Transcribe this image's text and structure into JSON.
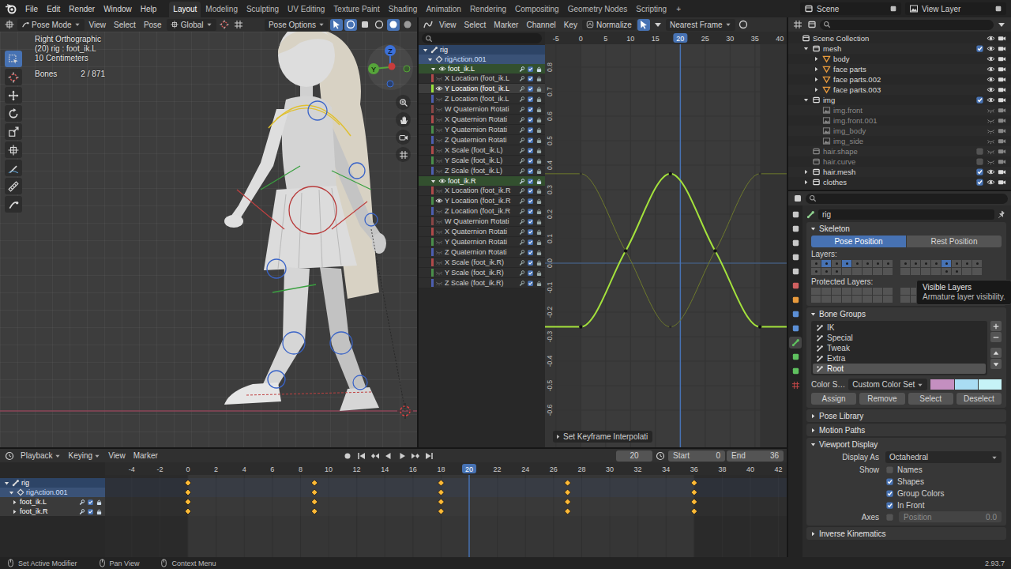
{
  "topbar": {
    "menus": [
      "File",
      "Edit",
      "Render",
      "Window",
      "Help"
    ],
    "workspaces": [
      {
        "label": "Layout",
        "selected": true
      },
      {
        "label": "Modeling",
        "selected": false
      },
      {
        "label": "Sculpting",
        "selected": false
      },
      {
        "label": "UV Editing",
        "selected": false
      },
      {
        "label": "Texture Paint",
        "selected": false
      },
      {
        "label": "Shading",
        "selected": false
      },
      {
        "label": "Animation",
        "selected": false
      },
      {
        "label": "Rendering",
        "selected": false
      },
      {
        "label": "Compositing",
        "selected": false
      },
      {
        "label": "Geometry Nodes",
        "selected": false
      },
      {
        "label": "Scripting",
        "selected": false
      }
    ],
    "add_tab": "+",
    "scene": "Scene",
    "view_layer": "View Layer"
  },
  "viewport": {
    "mode": "Pose Mode",
    "menus": [
      "View",
      "Select",
      "Pose"
    ],
    "orientation": "Global",
    "pose_options": "Pose Options",
    "info": [
      "Right Orthographic",
      "(20) rig : foot_ik.L",
      "10 Centimeters"
    ],
    "stats": {
      "label": "Bones",
      "value": "2 / 871"
    },
    "gizmo": {
      "up": "Z",
      "side": "Y"
    },
    "tools": [
      {
        "selected": true
      },
      {
        "selected": false
      },
      {
        "selected": false
      },
      {
        "selected": false
      },
      {
        "selected": false
      },
      {
        "selected": false
      },
      {
        "selected": false
      },
      {
        "selected": false
      },
      {
        "selected": false
      }
    ]
  },
  "graph": {
    "menus": [
      "View",
      "Select",
      "Marker",
      "Channel",
      "Key"
    ],
    "normalize": {
      "label": "Normalize",
      "on": false
    },
    "snap": "Nearest Frame",
    "channels": [
      {
        "label": "rig",
        "kind": "object",
        "expanded": true
      },
      {
        "label": "rigAction.001",
        "kind": "action",
        "expanded": true
      },
      {
        "label": "foot_ik.L",
        "kind": "group",
        "expanded": true
      },
      {
        "label": "X Location (foot_ik.L",
        "kind": "fcurve",
        "color": "#b04a4a",
        "visible": false,
        "selected": false
      },
      {
        "label": "Y Location (foot_ik.L",
        "kind": "fcurve",
        "color": "#9be03a",
        "visible": true,
        "selected": true
      },
      {
        "label": "Z Location (foot_ik.L",
        "kind": "fcurve",
        "color": "#4d5fb0",
        "visible": false,
        "selected": false
      },
      {
        "label": "W Quaternion Rotati",
        "kind": "fcurve",
        "color": "#8a4646",
        "visible": false,
        "selected": false
      },
      {
        "label": "X Quaternion Rotati",
        "kind": "fcurve",
        "color": "#b04a4a",
        "visible": false,
        "selected": false
      },
      {
        "label": "Y Quaternion Rotati",
        "kind": "fcurve",
        "color": "#4a8f4a",
        "visible": false,
        "selected": false
      },
      {
        "label": "Z Quaternion Rotati",
        "kind": "fcurve",
        "color": "#4d5fb0",
        "visible": false,
        "selected": false
      },
      {
        "label": "X Scale (foot_ik.L)",
        "kind": "fcurve",
        "color": "#b04a4a",
        "visible": false,
        "selected": false
      },
      {
        "label": "Y Scale (foot_ik.L)",
        "kind": "fcurve",
        "color": "#4a8f4a",
        "visible": false,
        "selected": false
      },
      {
        "label": "Z Scale (foot_ik.L)",
        "kind": "fcurve",
        "color": "#4d5fb0",
        "visible": false,
        "selected": false
      },
      {
        "label": "foot_ik.R",
        "kind": "group",
        "expanded": true
      },
      {
        "label": "X Location (foot_ik.R",
        "kind": "fcurve",
        "color": "#b04a4a",
        "visible": false,
        "selected": false
      },
      {
        "label": "Y Location (foot_ik.R",
        "kind": "fcurve",
        "color": "#4a8f4a",
        "visible": true,
        "selected": false
      },
      {
        "label": "Z Location (foot_ik.R",
        "kind": "fcurve",
        "color": "#4d5fb0",
        "visible": false,
        "selected": false
      },
      {
        "label": "W Quaternion Rotati",
        "kind": "fcurve",
        "color": "#8a4646",
        "visible": false,
        "selected": false
      },
      {
        "label": "X Quaternion Rotati",
        "kind": "fcurve",
        "color": "#b04a4a",
        "visible": false,
        "selected": false
      },
      {
        "label": "Y Quaternion Rotati",
        "kind": "fcurve",
        "color": "#4a8f4a",
        "visible": false,
        "selected": false
      },
      {
        "label": "Z Quaternion Rotati",
        "kind": "fcurve",
        "color": "#4d5fb0",
        "visible": false,
        "selected": false
      },
      {
        "label": "X Scale (foot_ik.R)",
        "kind": "fcurve",
        "color": "#b04a4a",
        "visible": false,
        "selected": false
      },
      {
        "label": "Y Scale (foot_ik.R)",
        "kind": "fcurve",
        "color": "#4a8f4a",
        "visible": false,
        "selected": false
      },
      {
        "label": "Z Scale (foot_ik.R)",
        "kind": "fcurve",
        "color": "#4d5fb0",
        "visible": false,
        "selected": false
      }
    ],
    "frame_ticks": [
      "-5",
      "0",
      "5",
      "10",
      "15",
      "20",
      "25",
      "30",
      "35",
      "40"
    ],
    "value_ticks": [
      "0.8",
      "0.7",
      "0.6",
      "0.5",
      "0.4",
      "0.3",
      "0.2",
      "0.1",
      "0.0",
      "-0.1",
      "-0.2",
      "-0.3",
      "-0.4",
      "-0.5",
      "-0.6"
    ],
    "current_frame": "20",
    "cursor_value": 0,
    "curves": [
      {
        "selected": false,
        "color": "#6e7a2c",
        "frames": [
          0,
          9,
          18,
          27,
          36
        ],
        "values": [
          0.365,
          0.05,
          -0.26,
          0.05,
          0.365
        ]
      },
      {
        "selected": true,
        "color": "#a4e23c",
        "frames": [
          0,
          9,
          18,
          27,
          36
        ],
        "values": [
          -0.26,
          0.05,
          0.365,
          0.05,
          -0.26
        ]
      }
    ],
    "operator_panel": "Set Keyframe Interpolati"
  },
  "outliner": {
    "rows": [
      {
        "name": "Scene Collection",
        "depth": 0,
        "kind": "scene",
        "visible": true
      },
      {
        "name": "mesh",
        "depth": 1,
        "kind": "collection",
        "expanded": true,
        "checked": true,
        "visible": true
      },
      {
        "name": "body",
        "depth": 2,
        "kind": "mesh",
        "expanded": false,
        "visible": true
      },
      {
        "name": "face parts",
        "depth": 2,
        "kind": "mesh",
        "expanded": false,
        "visible": true
      },
      {
        "name": "face parts.002",
        "depth": 2,
        "kind": "mesh",
        "expanded": false,
        "visible": true
      },
      {
        "name": "face parts.003",
        "depth": 2,
        "kind": "mesh",
        "expanded": false,
        "visible": true
      },
      {
        "name": "img",
        "depth": 1,
        "kind": "collection",
        "expanded": true,
        "checked": true,
        "visible": true
      },
      {
        "name": "img.front",
        "depth": 2,
        "kind": "image",
        "visible": false
      },
      {
        "name": "img.front.001",
        "depth": 2,
        "kind": "image",
        "visible": false
      },
      {
        "name": "img_body",
        "depth": 2,
        "kind": "image",
        "visible": false
      },
      {
        "name": "img_side",
        "depth": 2,
        "kind": "image",
        "visible": false
      },
      {
        "name": "hair.shape",
        "depth": 1,
        "kind": "collection",
        "checked": false,
        "visible": false
      },
      {
        "name": "hair.curve",
        "depth": 1,
        "kind": "collection",
        "checked": false,
        "visible": false
      },
      {
        "name": "hair.mesh",
        "depth": 1,
        "kind": "collection",
        "expanded": false,
        "checked": true,
        "visible": true
      },
      {
        "name": "clothes",
        "depth": 1,
        "kind": "collection",
        "expanded": false,
        "checked": true,
        "visible": true
      }
    ]
  },
  "properties": {
    "tabs": [
      {
        "selected": false
      },
      {
        "selected": false
      },
      {
        "selected": false
      },
      {
        "selected": false
      },
      {
        "selected": false
      },
      {
        "selected": false
      },
      {
        "selected": false
      },
      {
        "selected": false
      },
      {
        "selected": false
      },
      {
        "selected": true
      },
      {
        "selected": false
      },
      {
        "selected": false
      },
      {
        "selected": false
      }
    ],
    "object": "rig",
    "skeleton": {
      "title": "Skeleton",
      "expanded": true,
      "positions": [
        {
          "label": "Pose Position",
          "selected": true
        },
        {
          "label": "Rest Position",
          "selected": false
        }
      ],
      "layers_label": "Layers:",
      "layers": [
        {
          "on": false,
          "used": true
        },
        {
          "on": true,
          "used": true
        },
        {
          "on": false,
          "used": true
        },
        {
          "on": true,
          "used": true
        },
        {
          "on": false,
          "used": true
        },
        {
          "on": false,
          "used": true
        },
        {
          "on": false,
          "used": true
        },
        {
          "on": false,
          "used": true
        },
        {
          "on": false,
          "used": true
        },
        {
          "on": false,
          "used": true
        },
        {
          "on": false,
          "used": true
        },
        {
          "on": false,
          "used": false
        },
        {
          "on": false,
          "used": false
        },
        {
          "on": false,
          "used": false
        },
        {
          "on": false,
          "used": false
        },
        {
          "on": false,
          "used": false
        },
        {
          "on": false,
          "used": true
        },
        {
          "on": false,
          "used": true
        },
        {
          "on": false,
          "used": true
        },
        {
          "on": false,
          "used": true
        },
        {
          "on": true,
          "used": true
        },
        {
          "on": false,
          "used": true
        },
        {
          "on": false,
          "used": true
        },
        {
          "on": false,
          "used": true
        },
        {
          "on": false,
          "used": false
        },
        {
          "on": false,
          "used": false
        },
        {
          "on": false,
          "used": false
        },
        {
          "on": false,
          "used": false
        },
        {
          "on": false,
          "used": true
        },
        {
          "on": false,
          "used": true
        },
        {
          "on": false,
          "used": false
        },
        {
          "on": false,
          "used": false
        }
      ],
      "protected_label": "Protected Layers:",
      "protected": [
        false,
        false,
        false,
        false,
        false,
        false,
        false,
        false,
        false,
        false,
        false,
        false,
        false,
        false,
        false,
        false,
        false,
        false,
        false,
        false,
        false,
        false,
        false,
        false,
        false,
        false,
        false,
        false,
        false,
        false,
        false,
        false
      ]
    },
    "tooltip": {
      "title": "Visible Layers",
      "text": "Armature layer visibility."
    },
    "bone_groups": {
      "title": "Bone Groups",
      "expanded": true,
      "items": [
        {
          "name": "IK",
          "selected": false
        },
        {
          "name": "Special",
          "selected": false
        },
        {
          "name": "Tweak",
          "selected": false
        },
        {
          "name": "Extra",
          "selected": false
        },
        {
          "name": "Root",
          "selected": true
        }
      ],
      "color_label": "Color S…",
      "color_set": "Custom Color Set",
      "colors": [
        {
          "color": "#c48fc0"
        },
        {
          "color": "#a9dcf3"
        },
        {
          "color": "#c6f3f7"
        }
      ],
      "buttons": [
        "Assign",
        "Remove",
        "Select",
        "Deselect"
      ]
    },
    "panels": [
      {
        "title": "Pose Library",
        "expanded": false
      },
      {
        "title": "Motion Paths",
        "expanded": false
      }
    ],
    "viewport_display": {
      "title": "Viewport Display",
      "expanded": true,
      "display_as_label": "Display As",
      "display_as": "Octahedral",
      "show_label": "Show",
      "options": [
        {
          "label": "Names",
          "checked": false
        },
        {
          "label": "Shapes",
          "checked": true
        },
        {
          "label": "Group Colors",
          "checked": true
        },
        {
          "label": "In Front",
          "checked": true
        }
      ],
      "axes": {
        "label": "Axes",
        "checked": false,
        "field_label": "Position",
        "field_value": "0.0",
        "disabled": true
      }
    },
    "ik": {
      "title": "Inverse Kinematics",
      "expanded": false
    }
  },
  "timeline": {
    "menus": [
      {
        "label": "Playback",
        "dropdown": true
      },
      {
        "label": "Keying",
        "dropdown": true
      },
      {
        "label": "View",
        "dropdown": false
      },
      {
        "label": "Marker",
        "dropdown": false
      }
    ],
    "current_frame": "20",
    "start": {
      "label": "Start",
      "value": "0"
    },
    "end": {
      "label": "End",
      "value": "36"
    },
    "ruler": [
      "-4",
      "-2",
      "0",
      "2",
      "4",
      "6",
      "8",
      "10",
      "12",
      "14",
      "16",
      "18",
      "20",
      "22",
      "24",
      "26",
      "28",
      "30",
      "32",
      "34",
      "36",
      "38",
      "40",
      "42"
    ],
    "channels": [
      {
        "name": "rig",
        "kind": "object",
        "expanded": true,
        "keys": [
          0,
          9,
          18,
          27,
          36
        ],
        "keys_selected": true
      },
      {
        "name": "rigAction.001",
        "kind": "action",
        "expanded": true,
        "keys": [
          0,
          9,
          18,
          27,
          36
        ],
        "keys_selected": true
      },
      {
        "name": "foot_ik.L",
        "kind": "group",
        "expanded": false,
        "keys": [
          0,
          9,
          18,
          27,
          36
        ],
        "keys_selected": true
      },
      {
        "name": "foot_ik.R",
        "kind": "group",
        "expanded": false,
        "keys": [
          0,
          9,
          18,
          27,
          36
        ],
        "keys_selected": true
      }
    ]
  },
  "status_bar": {
    "items": [
      "Set Active Modifier",
      "Pan View",
      "Context Menu"
    ],
    "version": "2.93.7"
  }
}
